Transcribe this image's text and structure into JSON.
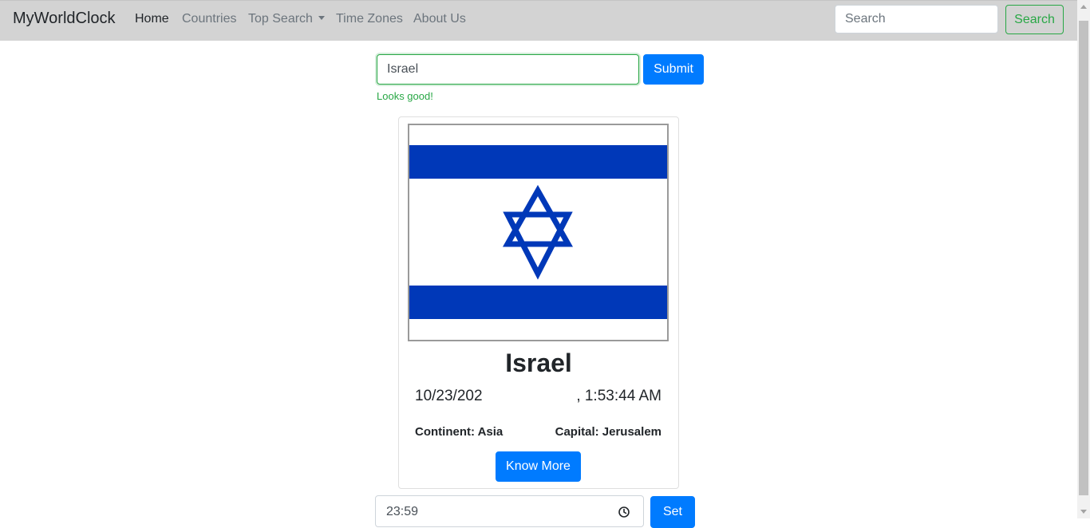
{
  "navbar": {
    "brand": "MyWorldClock",
    "links": [
      "Home",
      "Countries",
      "Top Search",
      "Time Zones",
      "About Us"
    ],
    "search_placeholder": "Search",
    "search_button": "Search"
  },
  "form": {
    "country_value": "Israel",
    "submit_label": "Submit",
    "feedback": "Looks good!"
  },
  "card": {
    "flag_icon": "israel-flag",
    "country": "Israel",
    "date": "10/23/202",
    "time": ", 1:53:44 AM",
    "continent": "Continent: Asia",
    "capital": "Capital: Jerusalem",
    "button_label": "Know More"
  },
  "alarm": {
    "time_value": "23:59",
    "set_label": "Set"
  },
  "colors": {
    "primary": "#007bff",
    "success": "#28a745",
    "navbar_bg": "#d3d3d3",
    "flag_blue": "#0038b8"
  }
}
